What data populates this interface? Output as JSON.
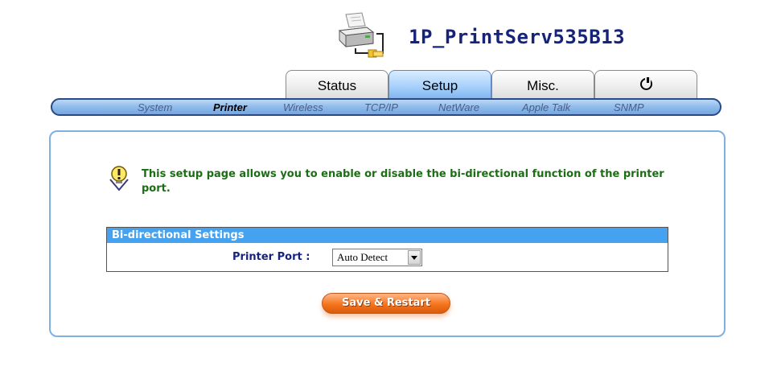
{
  "header": {
    "device_name": "1P_PrintServ535B13",
    "icon": "printer-network-icon"
  },
  "tabs": [
    {
      "label": "Status",
      "active": false
    },
    {
      "label": "Setup",
      "active": true
    },
    {
      "label": "Misc.",
      "active": false
    },
    {
      "label": "",
      "icon": "power-icon",
      "active": false
    }
  ],
  "subnav": [
    {
      "label": "System",
      "active": false
    },
    {
      "label": "Printer",
      "active": true
    },
    {
      "label": "Wireless",
      "active": false
    },
    {
      "label": "TCP/IP",
      "active": false
    },
    {
      "label": "NetWare",
      "active": false
    },
    {
      "label": "Apple Talk",
      "active": false
    },
    {
      "label": "SNMP",
      "active": false
    }
  ],
  "info": {
    "icon": "lightbulb-tip-icon",
    "text": "This setup page allows you to enable or disable the bi-directional function of the printer port."
  },
  "settings": {
    "title": "Bi-directional Settings",
    "printer_port_label": "Printer Port :",
    "printer_port_value": "Auto Detect"
  },
  "actions": {
    "save_label": "Save & Restart"
  },
  "colors": {
    "title": "#16237a",
    "info_text": "#1b6e14",
    "settings_header": "#44a2f0",
    "save_button": "#f5741c",
    "active_tab": "#a9d1fb"
  }
}
